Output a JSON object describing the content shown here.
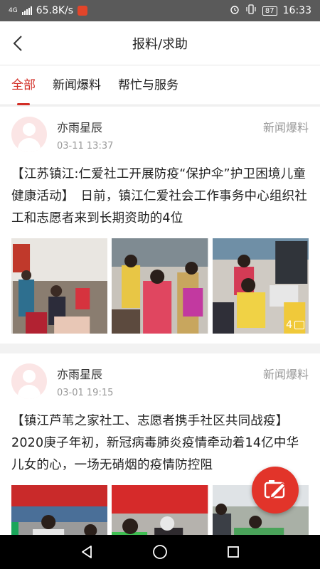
{
  "status_bar": {
    "network": "4G",
    "speed": "65.8K/s",
    "battery": "87",
    "time": "16:33"
  },
  "header": {
    "title": "报料/求助"
  },
  "tabs": [
    {
      "label": "全部",
      "active": true
    },
    {
      "label": "新闻爆料",
      "active": false
    },
    {
      "label": "帮忙与服务",
      "active": false
    }
  ],
  "posts": [
    {
      "author": "亦雨星辰",
      "time": "03-11 13:37",
      "category": "新闻爆料",
      "text": "【江苏镇江:仁爱社工开展防疫“保护伞”护卫困境儿童健康活动】　日前，镇江仁爱社会工作事务中心组织社工和志愿者来到长期资助的4位",
      "image_count": "4"
    },
    {
      "author": "亦雨星辰",
      "time": "03-01 19:15",
      "category": "新闻爆料",
      "text": "【镇江芦苇之家社工、志愿者携手社区共同战疫】2020庚子年初，新冠病毒肺炎疫情牵动着14亿中华儿女的心，一场无硝烟的疫情防控阻"
    }
  ],
  "colors": {
    "accent": "#d22e26",
    "fab": "#e2342a",
    "status_bar": "#5a5a5a"
  },
  "icons": {
    "back": "chevron-left-icon",
    "fab": "report-camera-icon",
    "nav_back": "triangle-back-icon",
    "nav_home": "circle-home-icon",
    "nav_recent": "square-recent-icon"
  }
}
